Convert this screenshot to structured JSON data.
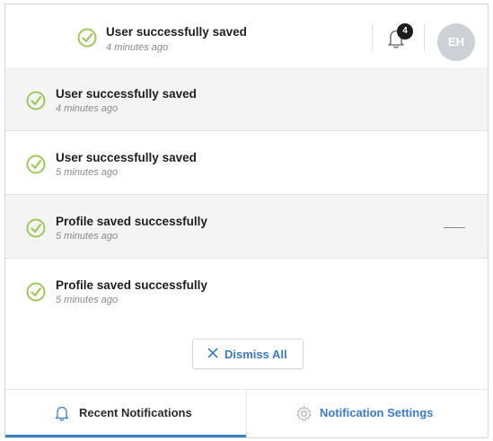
{
  "header": {
    "title": "User successfully saved",
    "time": "4 minutes ago",
    "notification_count": "4",
    "avatar_initials": "EH",
    "icons": {
      "status": "check-circle-icon",
      "bell": "bell-icon"
    }
  },
  "notifications": [
    {
      "title": "User successfully saved",
      "time": "4 minutes ago",
      "highlighted": true
    },
    {
      "title": "User successfully saved",
      "time": "5 minutes ago",
      "highlighted": false
    },
    {
      "title": "Profile saved successfully",
      "time": "5 minutes ago",
      "highlighted": true
    },
    {
      "title": "Profile saved successfully",
      "time": "5 minutes ago",
      "highlighted": false
    }
  ],
  "dismiss_all": {
    "label": "Dismiss All",
    "icon": "close-icon"
  },
  "tabs": [
    {
      "label": "Recent Notifications",
      "icon": "bell-icon",
      "active": true
    },
    {
      "label": "Notification Settings",
      "icon": "gear-icon",
      "active": false
    }
  ],
  "colors": {
    "success": "#9dc95b",
    "accent": "#3b82c4",
    "badge": "#1c1c1c",
    "avatar": "#cdd1d6",
    "row_highlight": "#f4f4f4"
  }
}
